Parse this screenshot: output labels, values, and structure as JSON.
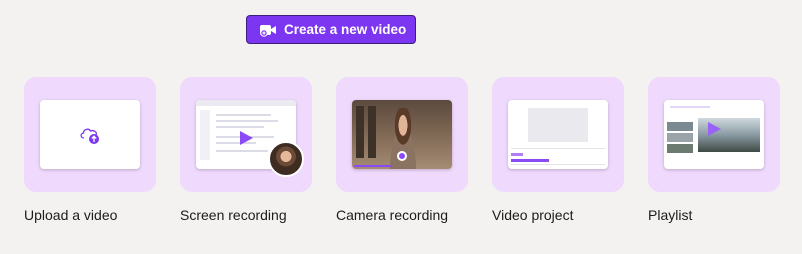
{
  "header": {
    "create_label": "Create a new video"
  },
  "cards": [
    {
      "label": "Upload a video"
    },
    {
      "label": "Screen recording"
    },
    {
      "label": "Camera recording"
    },
    {
      "label": "Video project"
    },
    {
      "label": "Playlist"
    }
  ],
  "colors": {
    "accent": "#7c35f0",
    "card_bg": "#efd9fd",
    "page_bg": "#f3f2f1"
  },
  "icons": {
    "create": "video-camera-plus-icon",
    "upload": "cloud-upload-icon",
    "play": "play-icon"
  }
}
